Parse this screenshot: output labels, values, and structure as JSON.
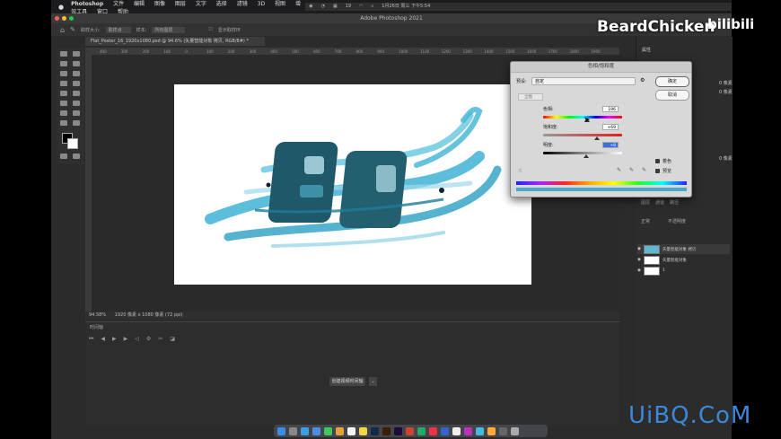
{
  "mac_menubar": {
    "app": "Photoshop",
    "menus": [
      "文件",
      "编辑",
      "图像",
      "图层",
      "文字",
      "选择",
      "滤镜",
      "3D",
      "视图",
      "增效工具",
      "窗口",
      "帮助"
    ],
    "battery": "19",
    "datetime": "1月26日 周三 下午5:54"
  },
  "window_title": "Adobe Photoshop 2021",
  "options_bar": {
    "sample_size_label": "取样大小:",
    "sample_size_value": "取样点",
    "sample_label": "样本:",
    "sample_value": "所有图层",
    "show_ring": "显示取样环"
  },
  "document_tab": "Flat_Poster_16_1920x1080.psd @ 94.6% (矢量智能对象 拷贝, RGB/8#) *",
  "ruler_ticks": [
    "400",
    "300",
    "200",
    "100",
    "0",
    "100",
    "200",
    "300",
    "400",
    "500",
    "600",
    "700",
    "800",
    "900",
    "1000",
    "1100",
    "1200",
    "1300",
    "1400",
    "1500",
    "1600",
    "1700",
    "1800",
    "1900"
  ],
  "status_bar": {
    "zoom": "94.58%",
    "doc_info": "1920 像素 x 1080 像素 (72 ppi)"
  },
  "timeline": {
    "title": "时间轴",
    "create_button": "创建视频时间轴"
  },
  "hue_sat_dialog": {
    "title": "色相/饱和度",
    "preset_label": "预设:",
    "preset_value": "自定",
    "channel": "全图",
    "hue_label": "色相:",
    "hue_value": "196",
    "saturation_label": "饱和度:",
    "saturation_value": "+69",
    "lightness_label": "明度:",
    "lightness_value": "+8",
    "ok": "确定",
    "cancel": "取消",
    "colorize_label": "着色",
    "preview_label": "预览"
  },
  "right_panel": {
    "properties_tab": "属性",
    "field1": "0 像素",
    "field2": "0 像素",
    "field3": "0 像素"
  },
  "layers_panel": {
    "tabs": [
      "图层",
      "通道",
      "路径"
    ],
    "blend": "正常",
    "opacity": "不透明度",
    "layers": [
      {
        "name": "矢量智能对象 拷贝",
        "selected": true
      },
      {
        "name": "矢量智能对象",
        "selected": false
      },
      {
        "name": "1",
        "selected": false
      }
    ]
  },
  "watermarks": {
    "beardchicken": "BeardChicken",
    "bilibili": "bilibili",
    "uibq": "UiBQ.CoM"
  },
  "colors": {
    "accent_blue": "#3b6fd6",
    "art_teal": "#2f9fbf",
    "art_dark": "#1d5566"
  }
}
